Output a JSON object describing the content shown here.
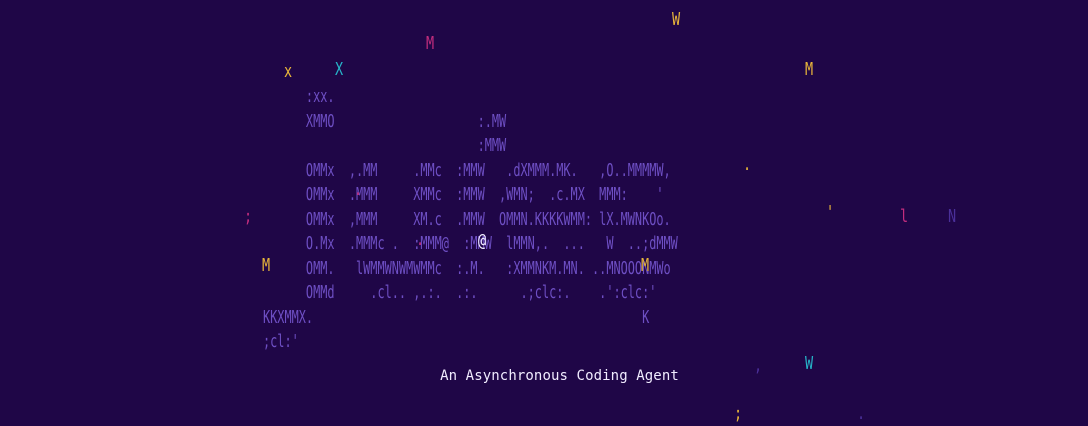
{
  "colors": {
    "background": "#1f0647",
    "art": "#6e4fc4",
    "tagline": "#f1ecff",
    "yellow": "#e8b53a",
    "cyan": "#27b4c9",
    "magenta": "#c22d7e",
    "dim": "#4a2f99",
    "white": "#f1ecff"
  },
  "logo_art": [
    "      :xx.",
    "      XMMO                    :.MW",
    "                              :MMW",
    "      OMMx  ,.MM     .MMc  :MMW   .dXMMM.MK.   ,O..MMMMW,",
    "      OMMx  .MMM     XMMc  :MMW  ,WMN;  .c.MX  MMM:    '",
    "      OMMx  ,MMM     XM.c  .MMW  OMMN.KKKKWMM: lX.MWNKOo.",
    "      O.Mx  .MMMc .  :MMM@  :MMW  lMMN,.  ...   W  ..;dMMW",
    "      OMM.   lWMMWNWMWMMc  :.M.   :XMMNKM.MN. ..MNOOONMWo",
    "      OMMd     .cl.. ,.:.  .:.      .;clc:.    .':clc:'",
    "KKXMMX.                                              K",
    ";cl:'"
  ],
  "floating_glyphs": [
    {
      "char": "W",
      "color": "yellow"
    },
    {
      "char": "M",
      "color": "magenta"
    },
    {
      "char": "x",
      "color": "yellow"
    },
    {
      "char": "X",
      "color": "cyan"
    },
    {
      "char": "M",
      "color": "yellow"
    },
    {
      "char": ";",
      "color": "magenta"
    },
    {
      "char": "l",
      "color": "magenta"
    },
    {
      "char": "N",
      "color": "dim"
    },
    {
      "char": "'",
      "color": "yellow"
    },
    {
      "char": "M",
      "color": "yellow"
    },
    {
      "char": "M",
      "color": "yellow"
    },
    {
      "char": ".",
      "color": "magenta"
    },
    {
      "char": ".",
      "color": "magenta"
    },
    {
      "char": ".",
      "color": "yellow"
    },
    {
      "char": "@",
      "color": "white"
    },
    {
      "char": "W",
      "color": "cyan"
    },
    {
      "char": ",",
      "color": "dim"
    },
    {
      "char": ";",
      "color": "yellow"
    },
    {
      "char": ".",
      "color": "dim"
    }
  ],
  "tagline": "An Asynchronous Coding Agent"
}
